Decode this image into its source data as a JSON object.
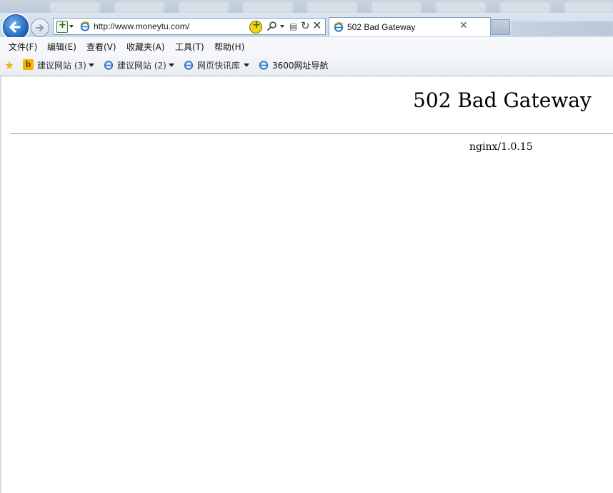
{
  "browser": {
    "url": "http://www.moneytu.com/",
    "tab_title": "502 Bad Gateway"
  },
  "menu": {
    "items": [
      "文件(F)",
      "编辑(E)",
      "查看(V)",
      "收藏夹(A)",
      "工具(T)",
      "帮助(H)"
    ]
  },
  "favorites": {
    "items": [
      "建议网站 (3)",
      "建议网站 (2)",
      "网页快讯库",
      "3600网址导航"
    ]
  },
  "page": {
    "heading": "502 Bad Gateway",
    "server": "nginx/1.0.15"
  },
  "colors": {
    "accent": "#1f5fb8",
    "favorites_star": "#e9b51c"
  }
}
